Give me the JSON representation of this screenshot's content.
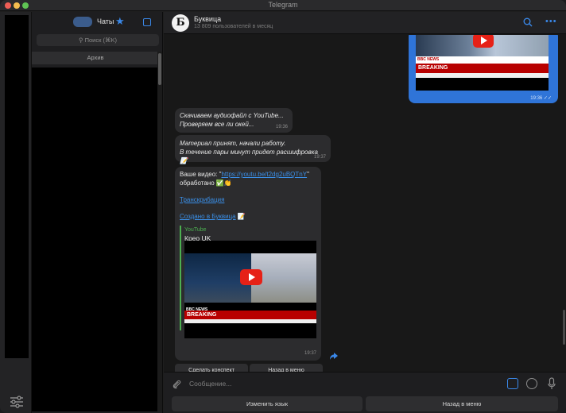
{
  "window": {
    "title": "Telegram"
  },
  "sidebar": {
    "title": "Чаты",
    "search_placeholder": "Поиск (⌘K)",
    "archive_label": "Архив"
  },
  "chat": {
    "name": "Буквица",
    "subtitle": "13 809 пользователей в месяц",
    "avatar_letter": "Б"
  },
  "messages": {
    "out_preview": {
      "bbc_label": "BBC NEWS",
      "breaking": "BREAKING",
      "time": "19:36 ✓✓"
    },
    "m1": {
      "line1": "Скачиваем аудиофайл с YouTube...",
      "line2": "Проверяем все ли окей...",
      "time": "19:36"
    },
    "m2": {
      "line1": "Материал принят, начали работу.",
      "line2": "В течение пары минут придет расшифровка 📝",
      "time": "19:37"
    },
    "m3": {
      "prefix": "Ваше видео: \"",
      "video_link": "https://youtu.be/t2dg2uBQTnY",
      "suffix": "\"",
      "line2": "обработано ✅👏",
      "transcript_link": "Транскрибация",
      "created_link": "Создано в Буквица",
      "created_emoji": "📝",
      "preview_source": "YouTube",
      "preview_title": "Креo UK",
      "bbc_label": "BBC NEWS",
      "breaking": "BREAKING",
      "time": "19:37"
    }
  },
  "inline_keyboard": {
    "summary": "Сделать конспект",
    "back": "Назад в меню"
  },
  "composer": {
    "placeholder": "Сообщение..."
  },
  "reply_keyboard": {
    "change_lang": "Изменить язык",
    "back": "Назад в меню"
  },
  "colors": {
    "accent": "#3a88e8",
    "outgoing": "#2f74d8",
    "bubble": "#2c2c2e"
  }
}
